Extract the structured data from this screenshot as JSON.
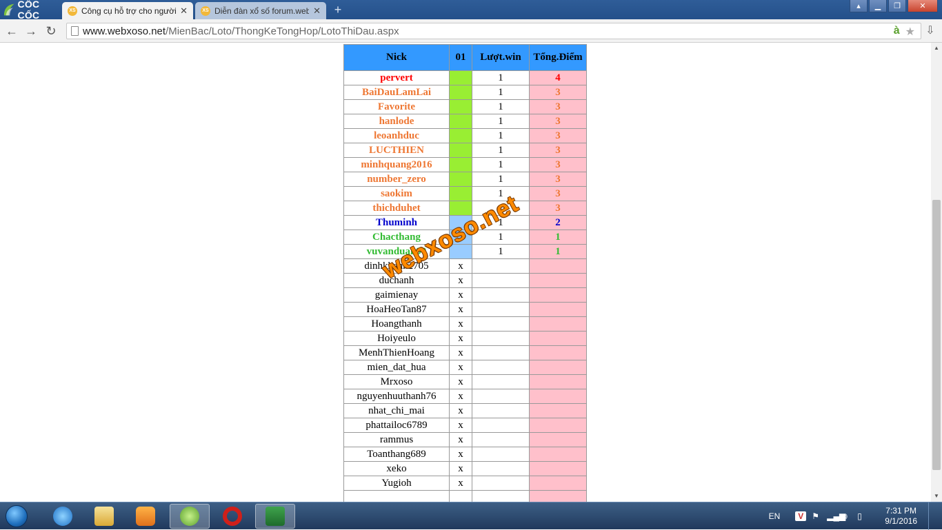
{
  "browser": {
    "brand": "CỐC CỐC",
    "tabs": [
      {
        "label": "Công cụ hỗ trợ cho người",
        "favicon": "XS",
        "active": true
      },
      {
        "label": "Diễn đàn xổ số forum.web",
        "favicon": "XS",
        "active": false
      }
    ],
    "url_host": "www.webxoso.net",
    "url_path": "/MienBac/Loto/ThongKeTongHop/LotoThiDau.aspx",
    "accent_color": "#2f5d98"
  },
  "table": {
    "headers": {
      "nick": "Nick",
      "col01": "01",
      "win": "Lượt.win",
      "points": "Tổng.Điểm"
    },
    "rows": [
      {
        "nick": "pervert",
        "col01": "",
        "win": "1",
        "points": "4",
        "color": "#ff0000",
        "status": "green"
      },
      {
        "nick": "BaiDauLamLai",
        "col01": "",
        "win": "1",
        "points": "3",
        "color": "#ee7733",
        "status": "green"
      },
      {
        "nick": "Favorite",
        "col01": "",
        "win": "1",
        "points": "3",
        "color": "#ee7733",
        "status": "green"
      },
      {
        "nick": "hanlode",
        "col01": "",
        "win": "1",
        "points": "3",
        "color": "#ee7733",
        "status": "green"
      },
      {
        "nick": "leoanhduc",
        "col01": "",
        "win": "1",
        "points": "3",
        "color": "#ee7733",
        "status": "green"
      },
      {
        "nick": "LUCTHIEN",
        "col01": "",
        "win": "1",
        "points": "3",
        "color": "#ee7733",
        "status": "green"
      },
      {
        "nick": "minhquang2016",
        "col01": "",
        "win": "1",
        "points": "3",
        "color": "#ee7733",
        "status": "green"
      },
      {
        "nick": "number_zero",
        "col01": "",
        "win": "1",
        "points": "3",
        "color": "#ee7733",
        "status": "green"
      },
      {
        "nick": "saokim",
        "col01": "",
        "win": "1",
        "points": "3",
        "color": "#ee7733",
        "status": "green"
      },
      {
        "nick": "thichduhet",
        "col01": "",
        "win": "1",
        "points": "3",
        "color": "#ee7733",
        "status": "green"
      },
      {
        "nick": "Thuminh",
        "col01": "",
        "win": "1",
        "points": "2",
        "color": "#0000cc",
        "status": "lblue"
      },
      {
        "nick": "Chacthang",
        "col01": "",
        "win": "1",
        "points": "1",
        "color": "#33bb33",
        "status": "lblue"
      },
      {
        "nick": "vuvanduan90",
        "col01": "",
        "win": "1",
        "points": "1",
        "color": "#33bb33",
        "status": "lblue"
      },
      {
        "nick": "dinhkhanh2705",
        "col01": "x",
        "win": "",
        "points": "",
        "color": "#000000",
        "status": "none"
      },
      {
        "nick": "duchanh",
        "col01": "x",
        "win": "",
        "points": "",
        "color": "#000000",
        "status": "none"
      },
      {
        "nick": "gaimienay",
        "col01": "x",
        "win": "",
        "points": "",
        "color": "#000000",
        "status": "none"
      },
      {
        "nick": "HoaHeoTan87",
        "col01": "x",
        "win": "",
        "points": "",
        "color": "#000000",
        "status": "none"
      },
      {
        "nick": "Hoangthanh",
        "col01": "x",
        "win": "",
        "points": "",
        "color": "#000000",
        "status": "none"
      },
      {
        "nick": "Hoiyeulo",
        "col01": "x",
        "win": "",
        "points": "",
        "color": "#000000",
        "status": "none"
      },
      {
        "nick": "MenhThienHoang",
        "col01": "x",
        "win": "",
        "points": "",
        "color": "#000000",
        "status": "none"
      },
      {
        "nick": "mien_dat_hua",
        "col01": "x",
        "win": "",
        "points": "",
        "color": "#000000",
        "status": "none"
      },
      {
        "nick": "Mrxoso",
        "col01": "x",
        "win": "",
        "points": "",
        "color": "#000000",
        "status": "none"
      },
      {
        "nick": "nguyenhuuthanh76",
        "col01": "x",
        "win": "",
        "points": "",
        "color": "#000000",
        "status": "none"
      },
      {
        "nick": "nhat_chi_mai",
        "col01": "x",
        "win": "",
        "points": "",
        "color": "#000000",
        "status": "none"
      },
      {
        "nick": "phattailoc6789",
        "col01": "x",
        "win": "",
        "points": "",
        "color": "#000000",
        "status": "none"
      },
      {
        "nick": "rammus",
        "col01": "x",
        "win": "",
        "points": "",
        "color": "#000000",
        "status": "none"
      },
      {
        "nick": "Toanthang689",
        "col01": "x",
        "win": "",
        "points": "",
        "color": "#000000",
        "status": "none"
      },
      {
        "nick": "xeko",
        "col01": "x",
        "win": "",
        "points": "",
        "color": "#000000",
        "status": "none"
      },
      {
        "nick": "Yugioh",
        "col01": "x",
        "win": "",
        "points": "",
        "color": "#000000",
        "status": "none"
      }
    ]
  },
  "watermark": "webxoso.net",
  "taskbar": {
    "lang": "EN",
    "time": "7:31 PM",
    "date": "9/1/2016",
    "apps": [
      "start-orb",
      "ie-icon",
      "explorer-icon",
      "media-player-icon",
      "coccoc-icon",
      "opera-icon",
      "excel-icon"
    ]
  }
}
